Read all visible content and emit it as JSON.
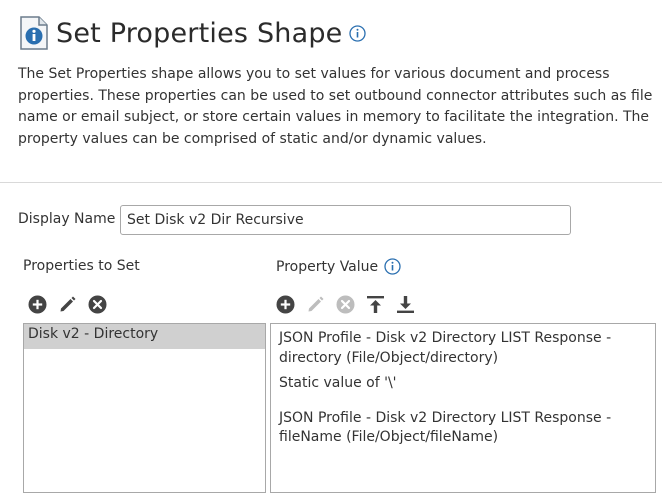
{
  "header": {
    "title": "Set Properties Shape",
    "icon": "document-info-icon"
  },
  "description": "The Set Properties shape allows you to set values for various document and process properties. These properties can be used to set outbound connector attributes such as file name or email subject, or store certain values in memory to facilitate the integration. The property values can be comprised of static and/or dynamic values.",
  "display_name": {
    "label": "Display Name",
    "value": "Set Disk v2 Dir Recursive"
  },
  "properties_to_set": {
    "label": "Properties to Set",
    "toolbar": [
      "add-icon",
      "edit-icon",
      "remove-icon"
    ],
    "items": [
      "Disk v2 - Directory"
    ]
  },
  "property_value": {
    "label": "Property Value",
    "toolbar": [
      "add-icon",
      "edit-icon",
      "remove-icon",
      "move-top-icon",
      "move-bottom-icon"
    ],
    "items": [
      "JSON Profile - Disk v2 Directory LIST Response - directory (File/Object/directory)",
      "Static value of '\\'",
      "JSON Profile - Disk v2 Directory LIST Response - fileName (File/Object/fileName)"
    ]
  },
  "colors": {
    "accent": "#2a6fb0",
    "icon_dark": "#444444",
    "icon_disabled": "#bdbdbd",
    "selected_row": "#d0d0d0"
  }
}
